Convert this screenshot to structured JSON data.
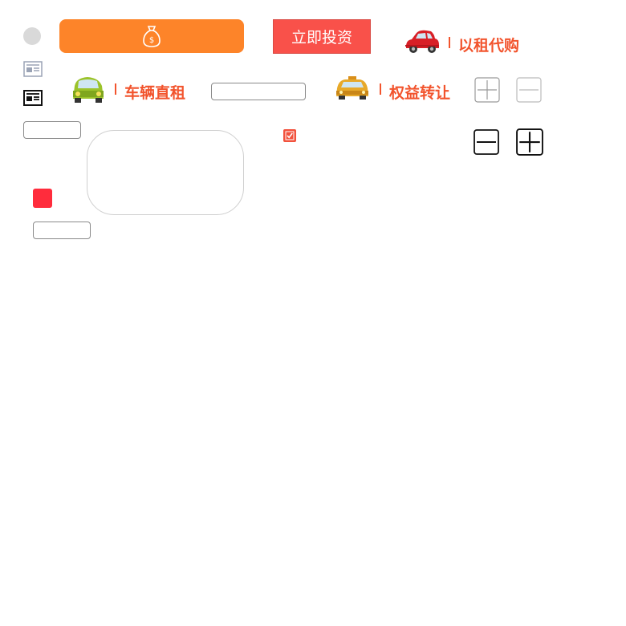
{
  "colors": {
    "orange": "#fd8429",
    "invest_red": "#f9514a",
    "label_red": "#f2542d",
    "alert_red": "#ff2c3c"
  },
  "top": {
    "money_icon": "money-bag-icon",
    "invest_label": "立即投资",
    "rent_to_buy_label": "以租代购"
  },
  "row2": {
    "direct_rent_label": "车辆直租",
    "equity_transfer_label": "权益转让"
  },
  "form": {
    "input1_value": "",
    "input2_value": "",
    "input3_value": "",
    "textarea_value": "",
    "checkbox_checked": true
  }
}
